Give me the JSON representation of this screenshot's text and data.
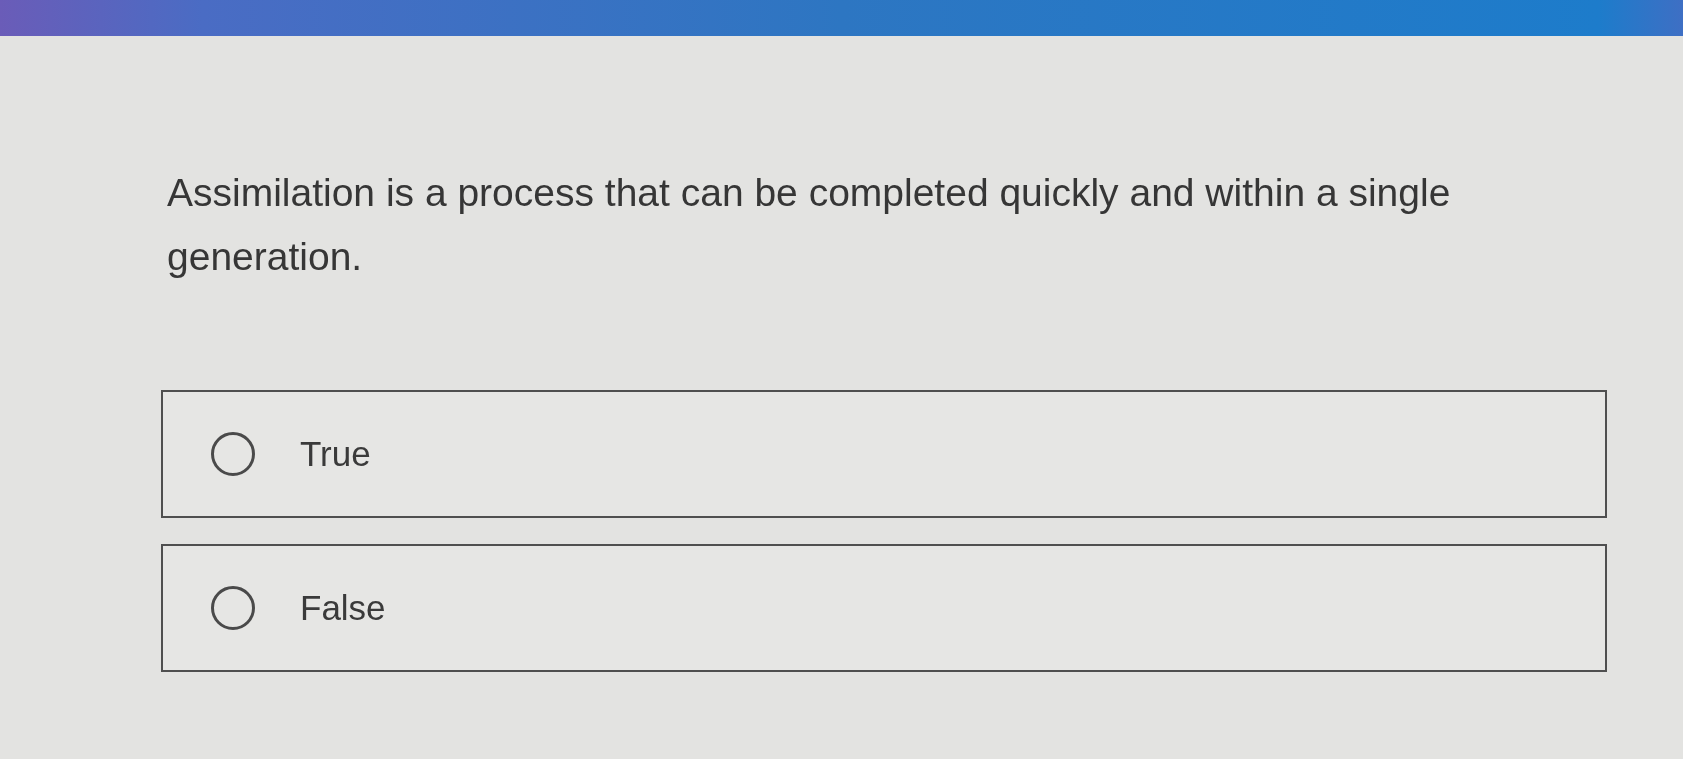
{
  "question": {
    "text": "Assimilation is a process that can be completed quickly and within a single generation."
  },
  "options": [
    {
      "label": "True",
      "selected": false
    },
    {
      "label": "False",
      "selected": false
    }
  ]
}
